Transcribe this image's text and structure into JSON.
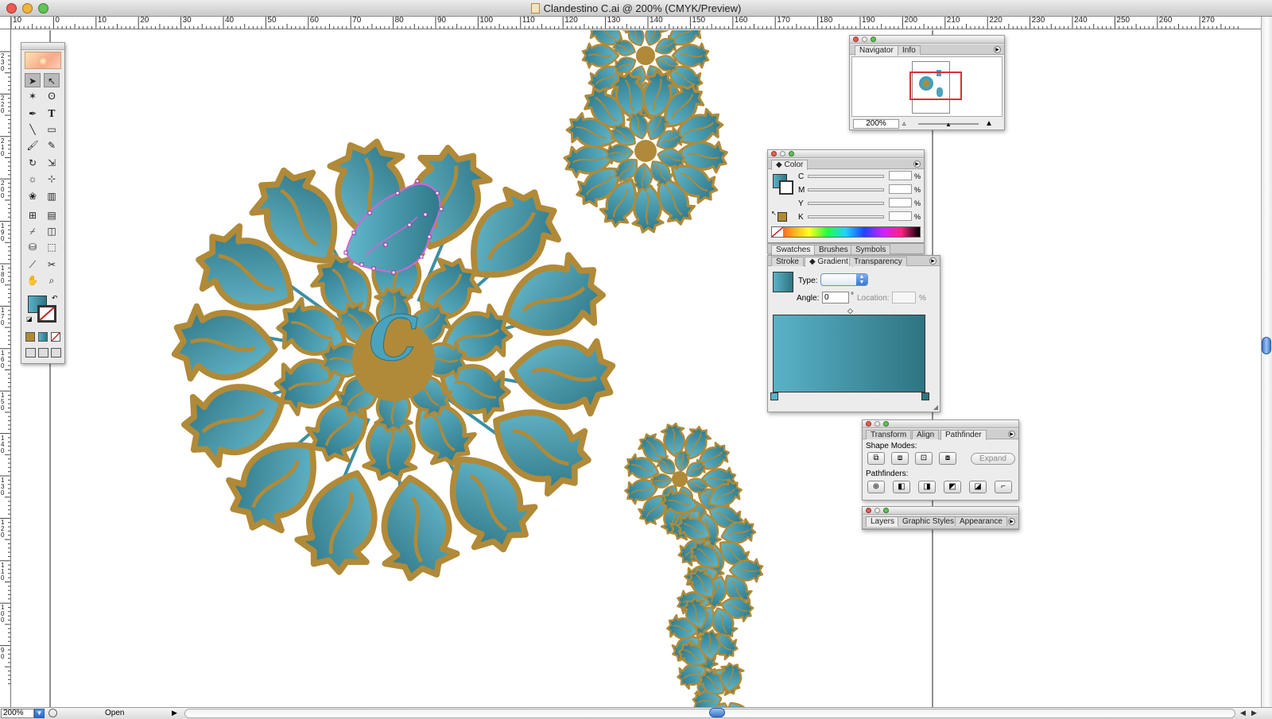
{
  "window": {
    "title": "Clandestino C.ai @ 200% (CMYK/Preview)",
    "colors": {
      "accent": "#4aa3bd",
      "gold": "#b08a38",
      "selection": "#cc4bcc"
    }
  },
  "rulers": {
    "horizontal": [
      "10",
      "0",
      "10",
      "20",
      "30",
      "40",
      "50",
      "60",
      "70",
      "80",
      "90",
      "100",
      "110",
      "120",
      "130",
      "140",
      "150",
      "160",
      "170",
      "180",
      "190",
      "200",
      "210",
      "220",
      "230",
      "240",
      "250",
      "260",
      "270"
    ],
    "vertical": [
      "230",
      "220",
      "210",
      "200",
      "190",
      "180",
      "170",
      "160",
      "150",
      "140",
      "130",
      "120",
      "110",
      "100",
      "90"
    ]
  },
  "artwork": {
    "center_letter": "C"
  },
  "status_bar": {
    "zoom": "200%",
    "status_text": "Open"
  },
  "toolbox": {
    "tools": [
      "selection-tool",
      "direct-selection-tool",
      "magic-wand-tool",
      "lasso-tool",
      "pen-tool",
      "type-tool",
      "line-tool",
      "rectangle-tool",
      "paintbrush-tool",
      "pencil-tool",
      "rotate-tool",
      "scale-tool",
      "warp-tool",
      "free-transform-tool",
      "symbol-sprayer-tool",
      "column-graph-tool",
      "mesh-tool",
      "gradient-tool",
      "eyedropper-tool",
      "blend-tool",
      "live-paint-tool",
      "live-paint-selection-tool",
      "slice-tool",
      "scissors-tool",
      "hand-tool",
      "zoom-tool"
    ]
  },
  "navigator_panel": {
    "tabs": [
      "Navigator",
      "Info"
    ],
    "zoom": "200%"
  },
  "color_panel": {
    "tab": "Color",
    "channels": [
      "C",
      "M",
      "Y",
      "K"
    ],
    "percent_sign": "%"
  },
  "swatches_row": {
    "tabs": [
      "Swatches",
      "Brushes",
      "Symbols"
    ]
  },
  "gradient_panel": {
    "tabs": [
      "Stroke",
      "Gradient",
      "Transparency"
    ],
    "type_label": "Type:",
    "angle_label": "Angle:",
    "angle_value": "0",
    "degree_sign": "°",
    "location_label": "Location:",
    "percent_sign": "%",
    "gradient_colors": [
      "#5ab2c8",
      "#2e7482"
    ]
  },
  "pathfinder_panel": {
    "tabs": [
      "Transform",
      "Align",
      "Pathfinder"
    ],
    "shape_modes_label": "Shape Modes:",
    "expand_label": "Expand",
    "pathfinders_label": "Pathfinders:"
  },
  "layers_panel": {
    "tabs": [
      "Layers",
      "Graphic Styles",
      "Appearance"
    ]
  }
}
